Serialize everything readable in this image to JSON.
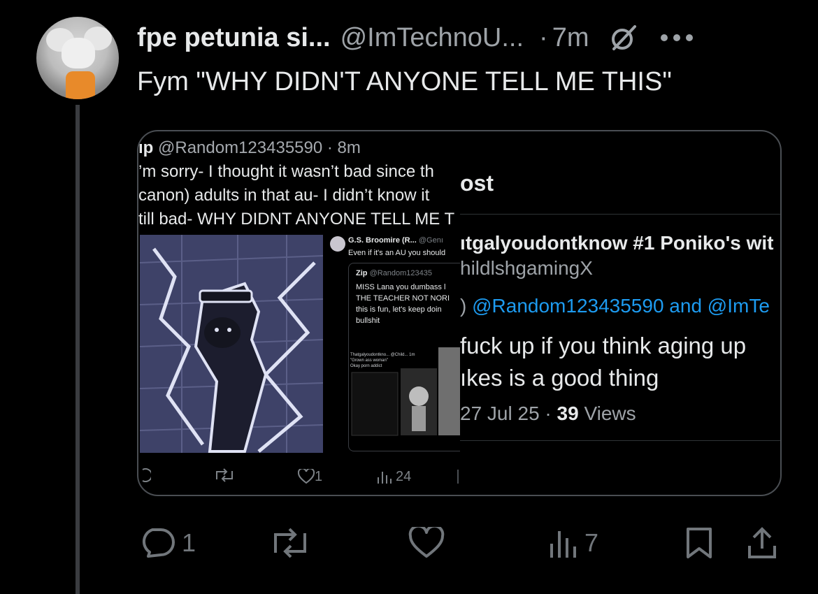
{
  "author": {
    "name": "fpe petunia si...",
    "handle": "@ImTechnoU...",
    "separator": "·",
    "time": "7m"
  },
  "tweet": {
    "text": "Fym \"WHY DIDN'T ANYONE TELL ME THIS\""
  },
  "quote": {
    "left": {
      "header_name": "ıp",
      "header_rest": "@Random123435590 · 8m",
      "lines": [
        "’m sorry- I thought it wasn’t bad since th",
        "canon) adults in that au- I didn’t know it",
        "till bad- WHY DIDNT ANYONE TELL ME T"
      ],
      "sub": {
        "name": "G.S. Broomire (R...",
        "handle": "@Genı",
        "text": "Even if it's an AU you should",
        "inner": {
          "name": "Zip",
          "handle": "@Random123435",
          "lines": [
            "MISS Lana you dumbass l",
            "THE TEACHER NOT NORI",
            "this is fun, let's keep doin",
            "bullshit"
          ],
          "mini": {
            "title": "Thatgalyoudontkno... @Child...  1m",
            "line1": "\"Grown ass woman\"",
            "line2": "Okay porn addict"
          }
        }
      },
      "actions": {
        "likes": "1",
        "views": "24"
      }
    },
    "right": {
      "title": "ost",
      "name": "ıtgalyoudontknow #1 Poniko's wit",
      "handle": "hildlshgamingX",
      "reply_prefix": ")",
      "reply_to": "@Random123435590 and @ImTe",
      "body_line1": "fuck up if you think aging up",
      "body_line2": "ıkes is a good thing",
      "date": "27 Jul 25 · ",
      "views_count": "39",
      "views_label": " Views"
    }
  },
  "actions": {
    "replies": "1",
    "views": "7"
  },
  "icons": [
    "grok-icon",
    "more-icon",
    "reply-icon",
    "retweet-icon",
    "like-icon",
    "views-icon",
    "bookmark-icon",
    "share-icon"
  ],
  "colors": {
    "background": "#000000",
    "text": "#e7e9ea",
    "secondary": "#71767b",
    "link": "#1d9bf0",
    "border": "#4a4e53"
  }
}
